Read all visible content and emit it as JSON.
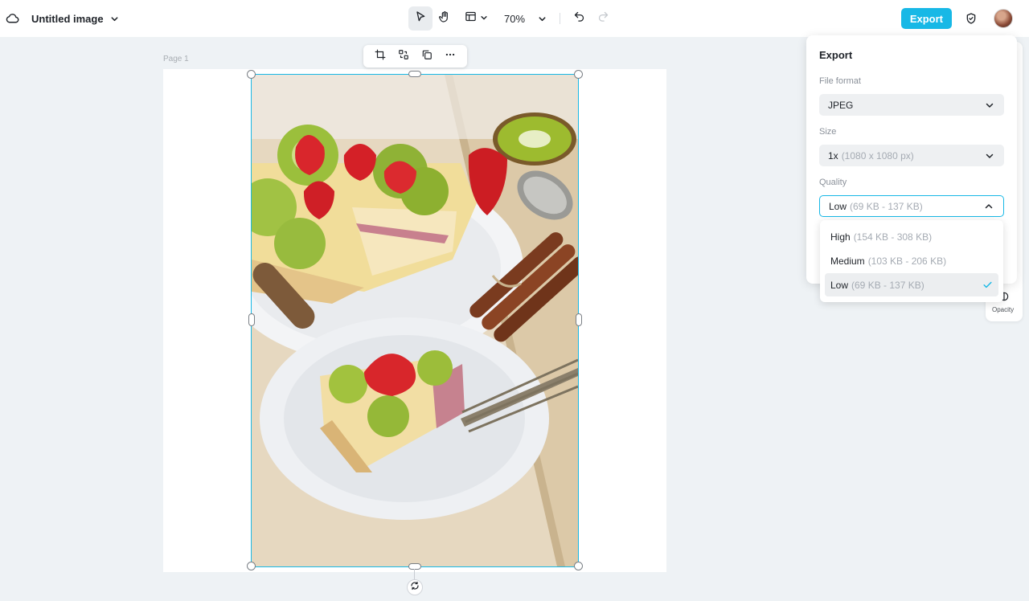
{
  "app": {
    "doc_title": "Untitled image"
  },
  "toolbar": {
    "zoom": "70%",
    "export_label": "Export"
  },
  "canvas": {
    "page_label": "Page 1"
  },
  "side_panel": {
    "opacity_label": "Opacity"
  },
  "export_panel": {
    "title": "Export",
    "file_format": {
      "label": "File format",
      "value": "JPEG"
    },
    "size": {
      "label": "Size",
      "value": "1x",
      "detail": "(1080 x 1080 px)"
    },
    "quality": {
      "label": "Quality",
      "value": "Low",
      "detail": "(69 KB - 137 KB)",
      "options": [
        {
          "name": "High",
          "detail": "(154 KB - 308 KB)",
          "selected": false
        },
        {
          "name": "Medium",
          "detail": "(103 KB - 206 KB)",
          "selected": false
        },
        {
          "name": "Low",
          "detail": "(69 KB - 137 KB)",
          "selected": true
        }
      ]
    }
  },
  "colors": {
    "accent": "#17b8e6",
    "check": "#17b8e6"
  }
}
